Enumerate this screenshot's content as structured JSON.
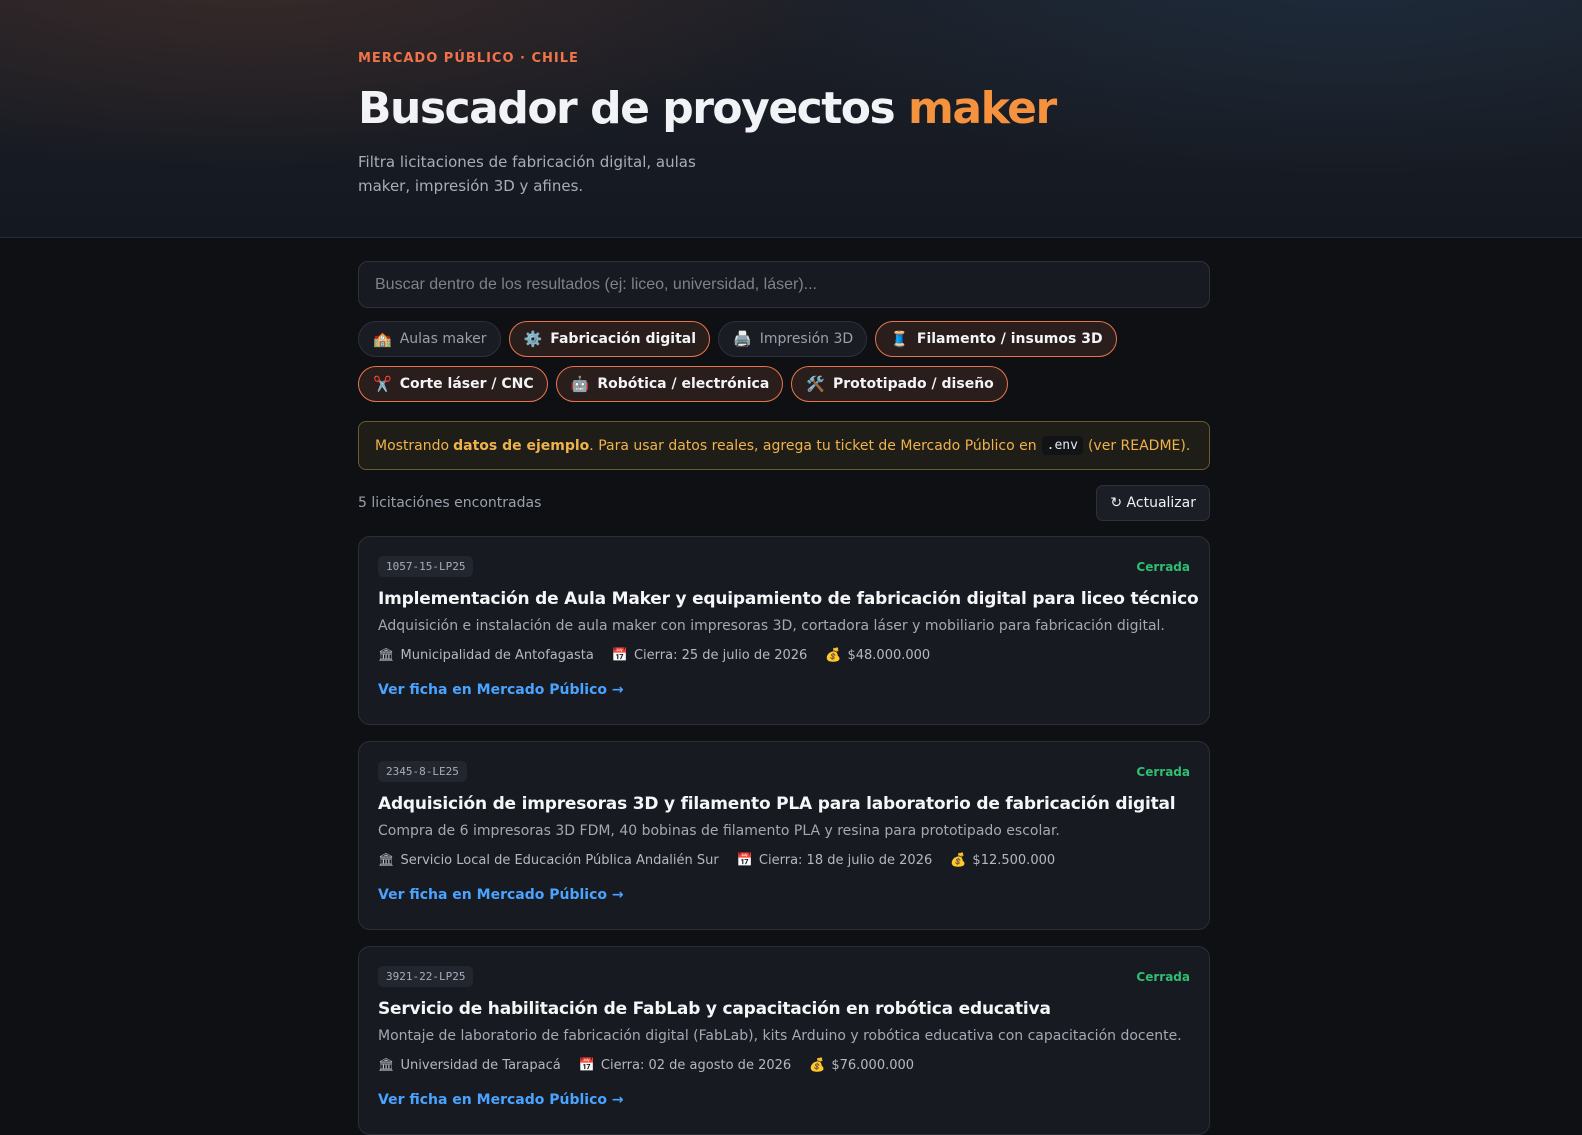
{
  "header": {
    "eyebrow": "MERCADO PÚBLICO · CHILE",
    "title_main": "Buscador de proyectos ",
    "title_accent": "maker",
    "subtitle": "Filtra licitaciones de fabricación digital, aulas maker, impresión 3D y afines."
  },
  "search": {
    "placeholder": "Buscar dentro de los resultados (ej: liceo, universidad, láser)...",
    "value": ""
  },
  "filters": [
    {
      "icon": "🏫",
      "icon_name": "school-icon",
      "label": "Aulas maker",
      "active": false
    },
    {
      "icon": "⚙️",
      "icon_name": "gear-icon",
      "label": "Fabricación digital",
      "active": true
    },
    {
      "icon": "🖨️",
      "icon_name": "printer-icon",
      "label": "Impresión 3D",
      "active": false
    },
    {
      "icon": "🧵",
      "icon_name": "thread-icon",
      "label": "Filamento / insumos 3D",
      "active": true
    },
    {
      "icon": "✂️",
      "icon_name": "scissors-icon",
      "label": "Corte láser / CNC",
      "active": true
    },
    {
      "icon": "🤖",
      "icon_name": "robot-icon",
      "label": "Robótica / electrónica",
      "active": true
    },
    {
      "icon": "🛠️",
      "icon_name": "tools-icon",
      "label": "Prototipado / diseño",
      "active": true
    }
  ],
  "notice": {
    "prefix": "Mostrando",
    "bold": "datos de ejemplo",
    "middle": ". Para usar datos reales, agrega tu ticket de Mercado Público en",
    "code": ".env",
    "suffix": "(ver README)."
  },
  "results": {
    "count_text": "5 licitaciónes encontradas",
    "refresh_label": "↻ Actualizar"
  },
  "tenders": [
    {
      "code": "1057-15-LP25",
      "status": "Cerrada",
      "title": "Implementación de Aula Maker y equipamiento de fabricación digital para liceo técnico",
      "description": "Adquisición e instalación de aula maker con impresoras 3D, cortadora láser y mobiliario para fabricación digital.",
      "org": "Municipalidad de Antofagasta",
      "closes": "Cierra: 25 de julio de 2026",
      "amount": "$48.000.000",
      "link": "Ver ficha en Mercado Público →"
    },
    {
      "code": "2345-8-LE25",
      "status": "Cerrada",
      "title": "Adquisición de impresoras 3D y filamento PLA para laboratorio de fabricación digital",
      "description": "Compra de 6 impresoras 3D FDM, 40 bobinas de filamento PLA y resina para prototipado escolar.",
      "org": "Servicio Local de Educación Pública Andalién Sur",
      "closes": "Cierra: 18 de julio de 2026",
      "amount": "$12.500.000",
      "link": "Ver ficha en Mercado Público →"
    },
    {
      "code": "3921-22-LP25",
      "status": "Cerrada",
      "title": "Servicio de habilitación de FabLab y capacitación en robótica educativa",
      "description": "Montaje de laboratorio de fabricación digital (FabLab), kits Arduino y robótica educativa con capacitación docente.",
      "org": "Universidad de Tarapacá",
      "closes": "Cierra: 02 de agosto de 2026",
      "amount": "$76.000.000",
      "link": "Ver ficha en Mercado Público →"
    }
  ],
  "meta_icons": {
    "org": "🏛",
    "org_name": "bank-icon",
    "date": "📅",
    "date_name": "calendar-icon",
    "amount": "💰",
    "amount_name": "money-bag-icon"
  },
  "colors": {
    "accent": "#f5923e",
    "eyebrow": "#f0734a",
    "link": "#4aa3ff",
    "status": "#2fbf71",
    "notice": "#f0b24a"
  }
}
